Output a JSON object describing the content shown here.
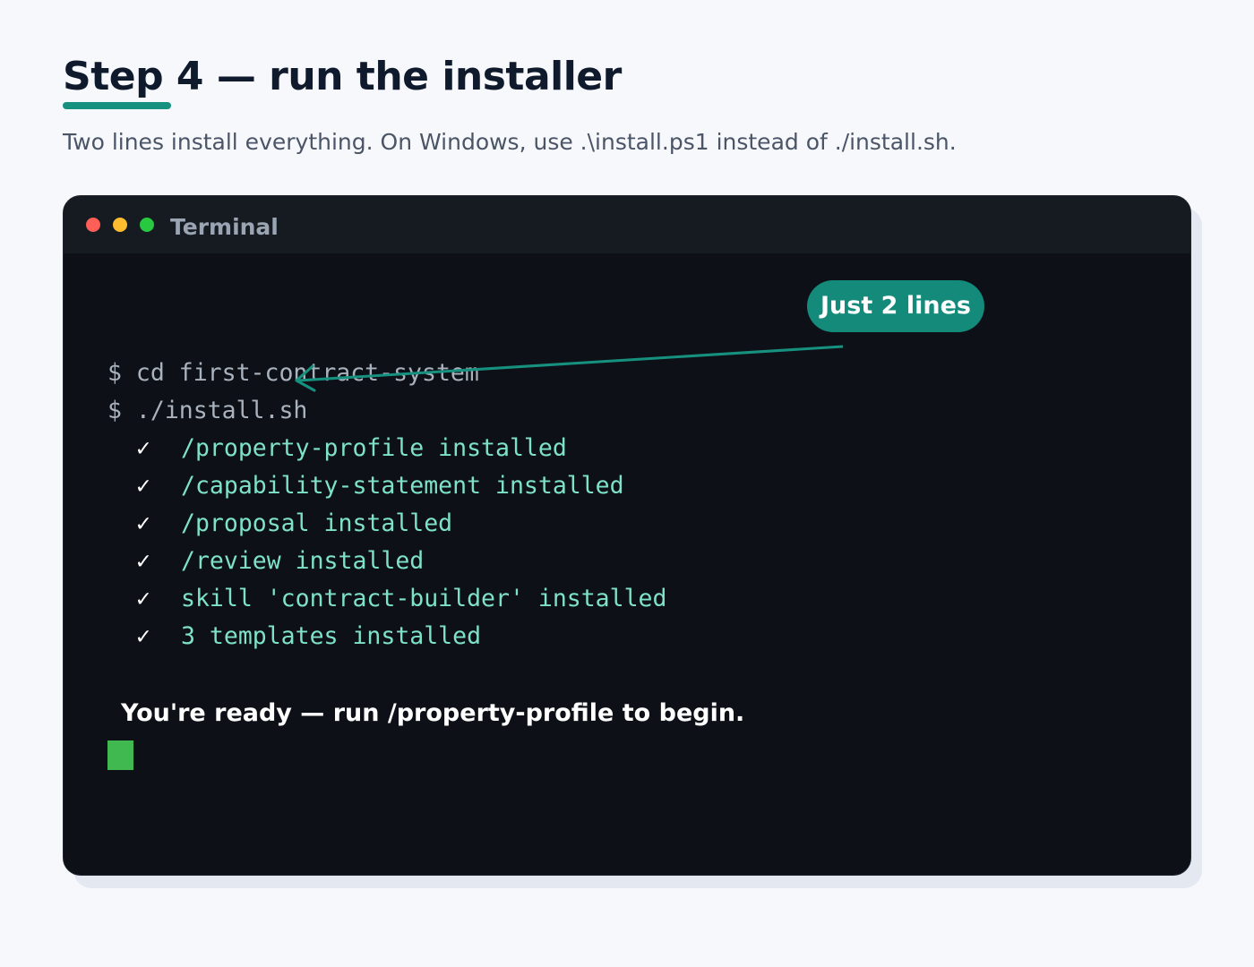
{
  "page": {
    "title": "Step 4 — run the installer",
    "subtitle": "Two lines install everything. On Windows, use .\\install.ps1 instead of ./install.sh."
  },
  "terminal": {
    "title": "Terminal",
    "callout": "Just 2 lines",
    "commands": [
      "$ cd first-contract-system",
      "$ ./install.sh"
    ],
    "check_glyph": "✓",
    "output": [
      "/property-profile installed",
      "/capability-statement installed",
      "/proposal installed",
      "/review installed",
      "skill 'contract-builder' installed",
      "3 templates installed"
    ],
    "ready_message": "You're ready — run /property-profile to begin."
  },
  "colors": {
    "accent": "#16917f",
    "terminal_bg": "#0d1117",
    "titlebar_bg": "#161b22",
    "output_text": "#7ee2c8",
    "cursor": "#3fb950"
  }
}
